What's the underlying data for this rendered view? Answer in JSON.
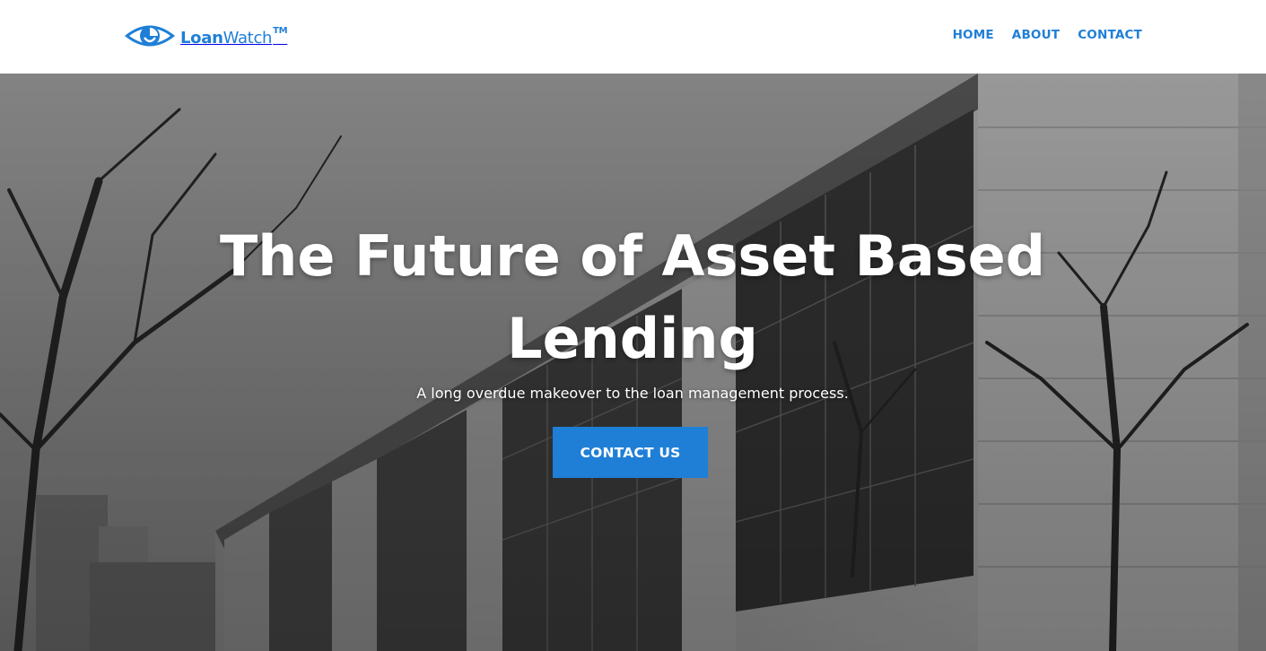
{
  "brand": {
    "name_bold": "Loan",
    "name_regular": "Watch",
    "trademark": "TM",
    "logo_icon": "eye-icon",
    "color": "#1f7fd7"
  },
  "nav": {
    "items": [
      "HOME",
      "ABOUT",
      "CONTACT"
    ]
  },
  "hero": {
    "title": "The Future of Asset Based Lending",
    "subtitle": "A long overdue makeover to the loan management process.",
    "cta_label": "CONTACT US",
    "background": "grayscale photo of modern office building with bare trees"
  }
}
